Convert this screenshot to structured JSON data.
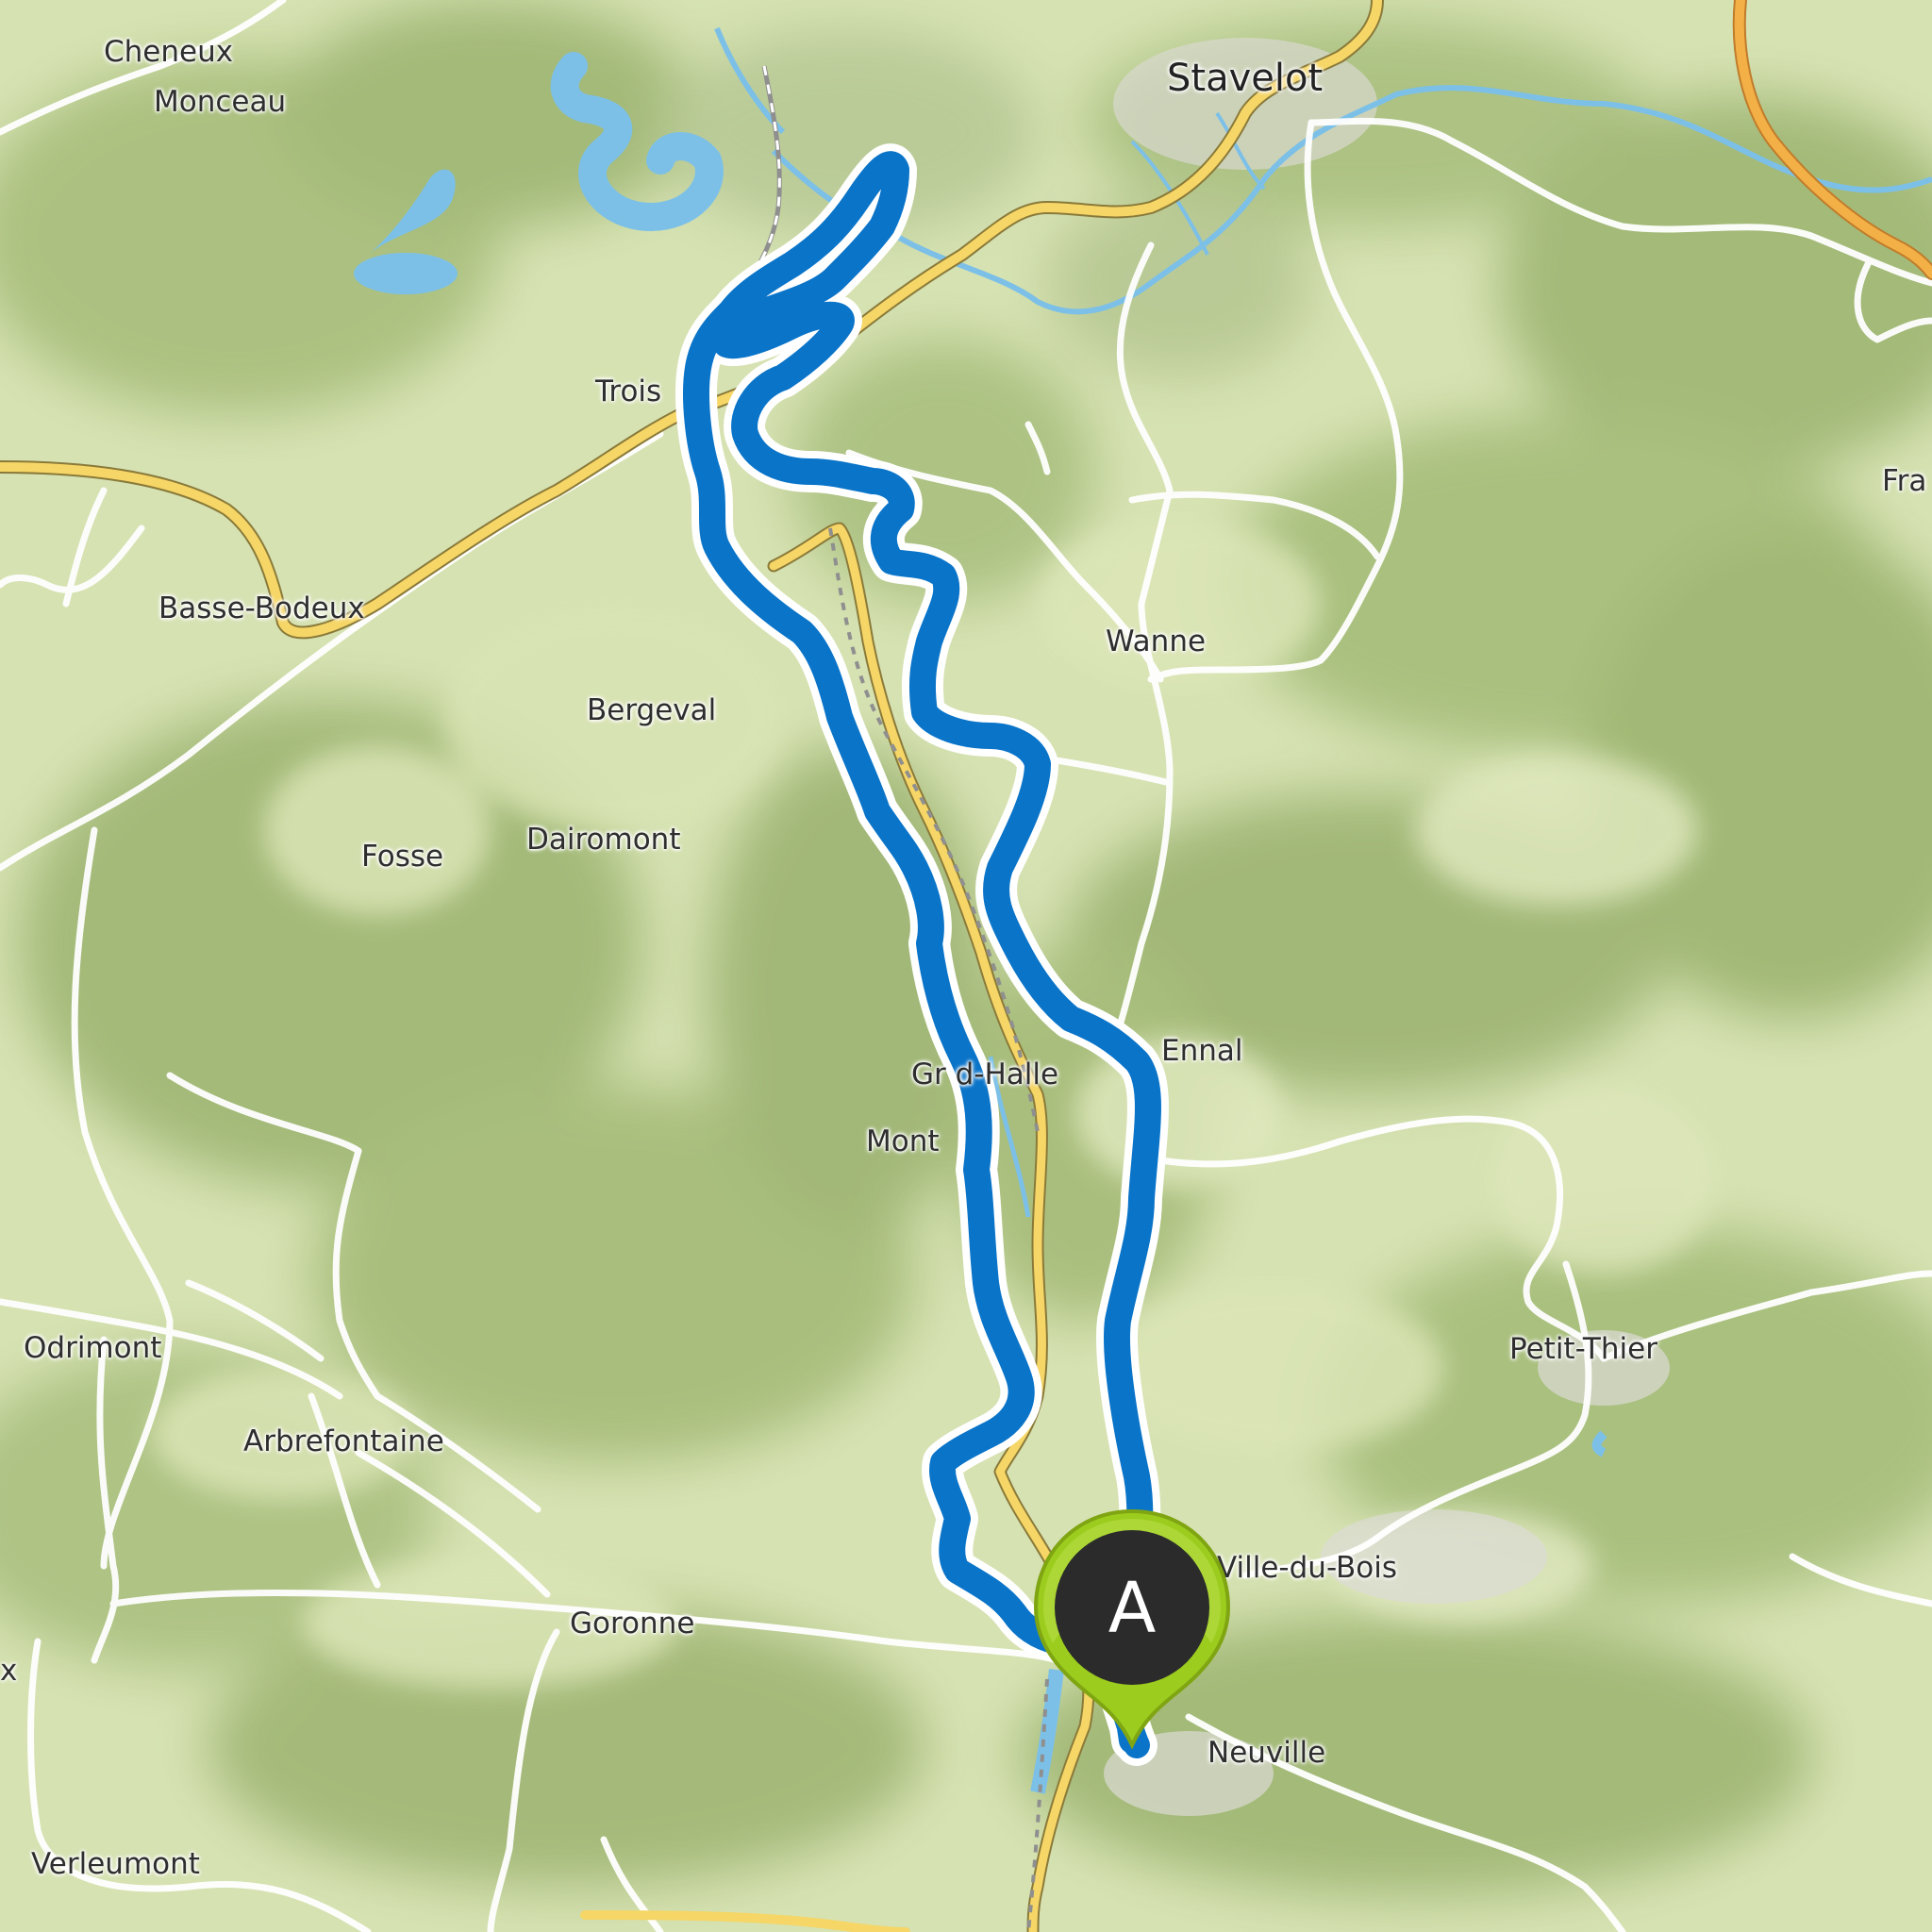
{
  "map": {
    "places": [
      {
        "id": "cheneux",
        "label": "Cheneux"
      },
      {
        "id": "monceau",
        "label": "Monceau"
      },
      {
        "id": "stavelot",
        "label": "Stavelot"
      },
      {
        "id": "trois",
        "label": "Trois"
      },
      {
        "id": "fra",
        "label": "Fra"
      },
      {
        "id": "basse-bodeux",
        "label": "Basse-Bodeux"
      },
      {
        "id": "wanne",
        "label": "Wanne"
      },
      {
        "id": "bergeval",
        "label": "Bergeval"
      },
      {
        "id": "fosse",
        "label": "Fosse"
      },
      {
        "id": "dairomont",
        "label": "Dairomont"
      },
      {
        "id": "ennal",
        "label": "Ennal"
      },
      {
        "id": "grand-halleux",
        "label": "Gr  d-Halle"
      },
      {
        "id": "mont",
        "label": "Mont"
      },
      {
        "id": "odrimont",
        "label": "Odrimont"
      },
      {
        "id": "petit-thier",
        "label": "Petit-Thier"
      },
      {
        "id": "arbrefontaine",
        "label": "Arbrefontaine"
      },
      {
        "id": "ville-du-bois",
        "label": "Ville-du-Bois"
      },
      {
        "id": "goronne",
        "label": "Goronne"
      },
      {
        "id": "x",
        "label": "x"
      },
      {
        "id": "neuville",
        "label": "Neuville"
      },
      {
        "id": "verleumont",
        "label": "Verleumont"
      }
    ],
    "marker": {
      "letter": "A",
      "color": "#9ccc1d",
      "fill": "#2b2b2b"
    },
    "route_color": "#0a74c9",
    "colors": {
      "land": "#cfdcaa",
      "forest": "#a9c07f",
      "water": "#76bde6",
      "major_road": "#f4d35e",
      "motorway": "#f2a93b",
      "minor_road": "#ffffff"
    }
  }
}
